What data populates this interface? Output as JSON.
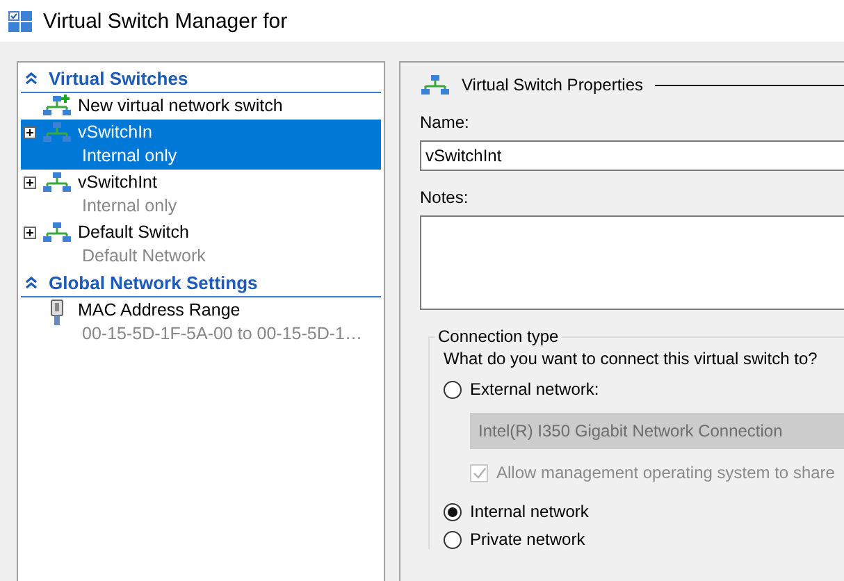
{
  "window": {
    "title": "Virtual Switch Manager for"
  },
  "sidebar": {
    "sections": [
      {
        "title": "Virtual Switches",
        "items": [
          {
            "kind": "action",
            "name": "New virtual network switch",
            "selected": false
          },
          {
            "kind": "switch",
            "name": "vSwitchIn",
            "subtitle": "Internal only",
            "selected": true
          },
          {
            "kind": "switch",
            "name": "vSwitchInt",
            "subtitle": "Internal only",
            "selected": false
          },
          {
            "kind": "switch",
            "name": "Default Switch",
            "subtitle": "Default Network",
            "selected": false
          }
        ]
      },
      {
        "title": "Global Network Settings",
        "items": [
          {
            "kind": "setting",
            "name": "MAC Address Range",
            "subtitle": "00-15-5D-1F-5A-00 to 00-15-5D-1…",
            "selected": false
          }
        ]
      }
    ]
  },
  "properties": {
    "title": "Virtual Switch Properties",
    "name_label": "Name:",
    "name_value": "vSwitchInt",
    "notes_label": "Notes:",
    "connection": {
      "title": "Connection type",
      "question": "What do you want to connect this virtual switch to?",
      "options": [
        {
          "label": "External network:",
          "selected": false,
          "adapter": {
            "value": "Intel(R) I350 Gigabit Network Connection",
            "disabled": true
          },
          "allow_management": {
            "label": "Allow management operating system to share",
            "checked": true,
            "disabled": true
          }
        },
        {
          "label": "Internal network",
          "selected": true
        },
        {
          "label": "Private network",
          "selected": false
        }
      ]
    }
  }
}
